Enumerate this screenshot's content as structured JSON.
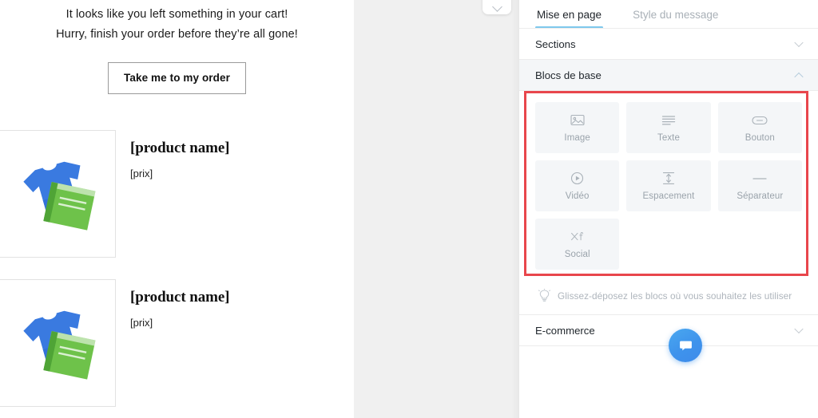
{
  "theme": {
    "accent": "#7ec8ec",
    "annotation_color": "#e8464c",
    "fab_color": "#3e93ec",
    "panel_bg": "#f4f6f8",
    "gutter_bg": "#f0f0f0"
  },
  "email_preview": {
    "headline_line_1": "It looks like you left something in your cart!",
    "headline_line_2": "Hurry, finish your order before they’re all gone!",
    "cta_label": "Take me to my order",
    "products": [
      {
        "name": "[product name]",
        "price": "[prix]",
        "image": "tshirt-book-placeholder-image"
      },
      {
        "name": "[product name]",
        "price": "[prix]",
        "image": "tshirt-book-placeholder-image"
      }
    ]
  },
  "gutter": {
    "collapse_icon": "chevron-down-icon"
  },
  "right_panel": {
    "tabs": [
      {
        "label": "Mise en page",
        "active": true
      },
      {
        "label": "Style du message",
        "active": false
      }
    ],
    "sections": [
      {
        "label": "Sections",
        "expanded": false,
        "chevron": "chevron-down-icon"
      },
      {
        "label": "Blocs de base",
        "expanded": true,
        "chevron": "chevron-up-icon"
      }
    ],
    "blocks": [
      {
        "label": "Image",
        "icon": "image-icon"
      },
      {
        "label": "Texte",
        "icon": "text-lines-icon"
      },
      {
        "label": "Bouton",
        "icon": "button-pill-icon"
      },
      {
        "label": "Vidéo",
        "icon": "play-circle-icon"
      },
      {
        "label": "Espacement",
        "icon": "vertical-spacing-icon"
      },
      {
        "label": "Séparateur",
        "icon": "horizontal-rule-icon"
      },
      {
        "label": "Social",
        "icon": "social-x-facebook-icon"
      }
    ],
    "hint": {
      "icon": "lightbulb-icon",
      "text": "Glissez-déposez les blocs où vous souhaitez les utiliser"
    },
    "ecommerce_section": {
      "label": "E-commerce",
      "expanded": false,
      "chevron": "chevron-down-icon"
    },
    "chat_fab": {
      "icon": "chat-bubble-icon"
    }
  }
}
